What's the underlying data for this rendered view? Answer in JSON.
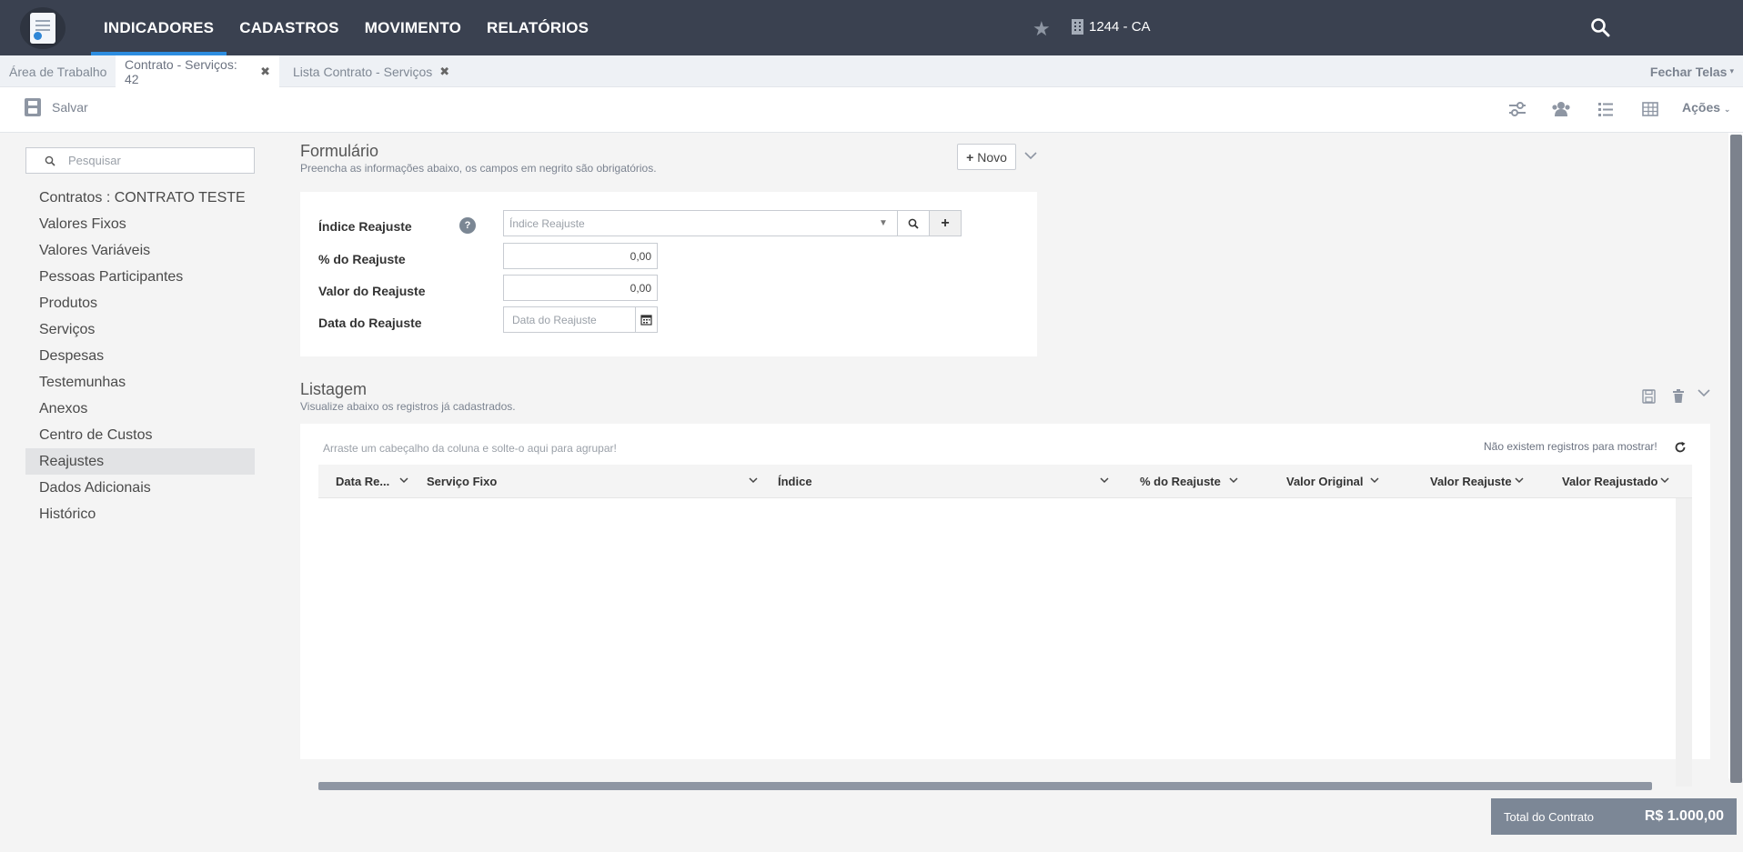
{
  "nav": {
    "items": [
      "INDICADORES",
      "CADASTROS",
      "MOVIMENTO",
      "RELATÓRIOS"
    ],
    "company": "1244 - CA"
  },
  "tabs": {
    "items": [
      {
        "label": "Área de Trabalho"
      },
      {
        "label": "Contrato - Serviços: 42"
      },
      {
        "label": "Lista Contrato - Serviços"
      }
    ],
    "close_all": "Fechar Telas"
  },
  "toolbar": {
    "save_label": "Salvar",
    "actions_label": "Ações"
  },
  "sidebar": {
    "search_placeholder": "Pesquisar",
    "items": [
      "Contratos : CONTRATO TESTE",
      "Valores Fixos",
      "Valores Variáveis",
      "Pessoas Participantes",
      "Produtos",
      "Serviços",
      "Despesas",
      "Testemunhas",
      "Anexos",
      "Centro de Custos",
      "Reajustes",
      "Dados Adicionais",
      "Histórico"
    ],
    "active": "Reajustes"
  },
  "form": {
    "title": "Formulário",
    "subtitle": "Preencha as informações abaixo, os campos em negrito são obrigatórios.",
    "new_button": "Novo",
    "fields": {
      "indice_label": "Índice Reajuste",
      "indice_placeholder": "Índice Reajuste",
      "percent_label": "% do Reajuste",
      "percent_value": "0,00",
      "valor_label": "Valor do Reajuste",
      "valor_value": "0,00",
      "data_label": "Data do Reajuste",
      "data_placeholder": "Data do Reajuste"
    }
  },
  "listing": {
    "title": "Listagem",
    "subtitle": "Visualize abaixo os registros já cadastrados.",
    "drag_hint": "Arraste um cabeçalho da coluna e solte-o aqui para agrupar!",
    "empty_message": "Não existem registros para mostrar!",
    "columns": [
      "Data Re...",
      "Serviço Fixo",
      "Índice",
      "% do Reajuste",
      "Valor Original",
      "Valor Reajuste",
      "Valor Reajustado"
    ]
  },
  "footer": {
    "total_label": "Total do Contrato",
    "total_value": "R$ 1.000,00"
  },
  "colors": {
    "topbar": "#3a4150",
    "accent": "#2d8de0",
    "total_bar": "#7c8796"
  }
}
